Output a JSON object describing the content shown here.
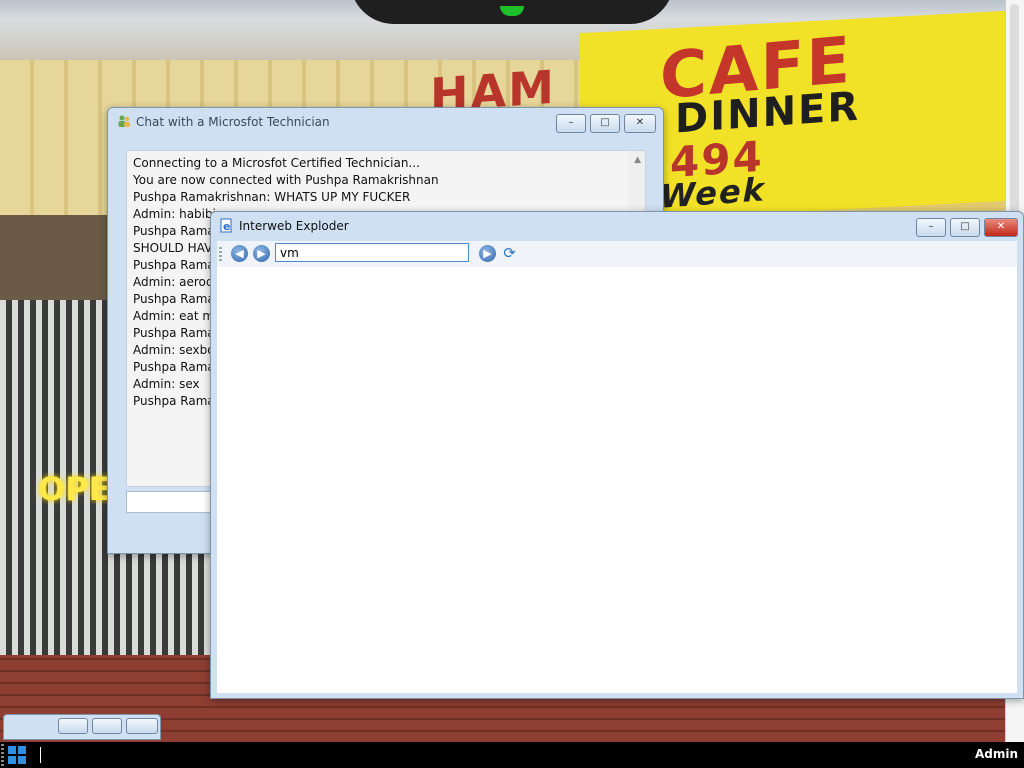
{
  "wallpaper": {
    "sign_ham": "HAM",
    "sign_cafe": "CAFE",
    "sign_dinner": "DINNER",
    "sign_number": "494",
    "sign_week": "Week",
    "open_sign": "OPEN"
  },
  "chat_window": {
    "title": "Chat with a Microsfot Technician",
    "icon": "chat-users-icon",
    "controls": {
      "minimize": "–",
      "maximize": "□",
      "close": "✕"
    },
    "messages": [
      "Connecting to a Microsfot Certified Technician...",
      "You are now connected with Pushpa Ramakrishnan",
      "Pushpa Ramakrishnan: WHATS UP MY FUCKER",
      "Admin: habibi",
      "Pushpa Ramal",
      "SHOULD HAV",
      "Pushpa Ramal",
      "Admin: aerocc",
      "Pushpa Ramal",
      "Admin: eat my",
      "Pushpa Ramal",
      "Admin: sexbor",
      "Pushpa Ramal",
      "Admin: sex",
      "Pushpa Ramal"
    ],
    "scroll_up": "▲"
  },
  "browser_window": {
    "title": "Interweb Exploder",
    "icon": "ie-logo-icon",
    "controls": {
      "minimize": "–",
      "maximize": "□",
      "close": "✕"
    },
    "back": "◀",
    "forward": "▶",
    "url_value": "vm",
    "go": "▶",
    "refresh": "⟳"
  },
  "taskbar": {
    "user": "Admin",
    "start_icon": "windows-logo-icon"
  },
  "colors": {
    "window_frame": "#cfe0f2",
    "close_red": "#c1281a",
    "taskbar": "#000000",
    "url_border": "#4a8ad1"
  }
}
